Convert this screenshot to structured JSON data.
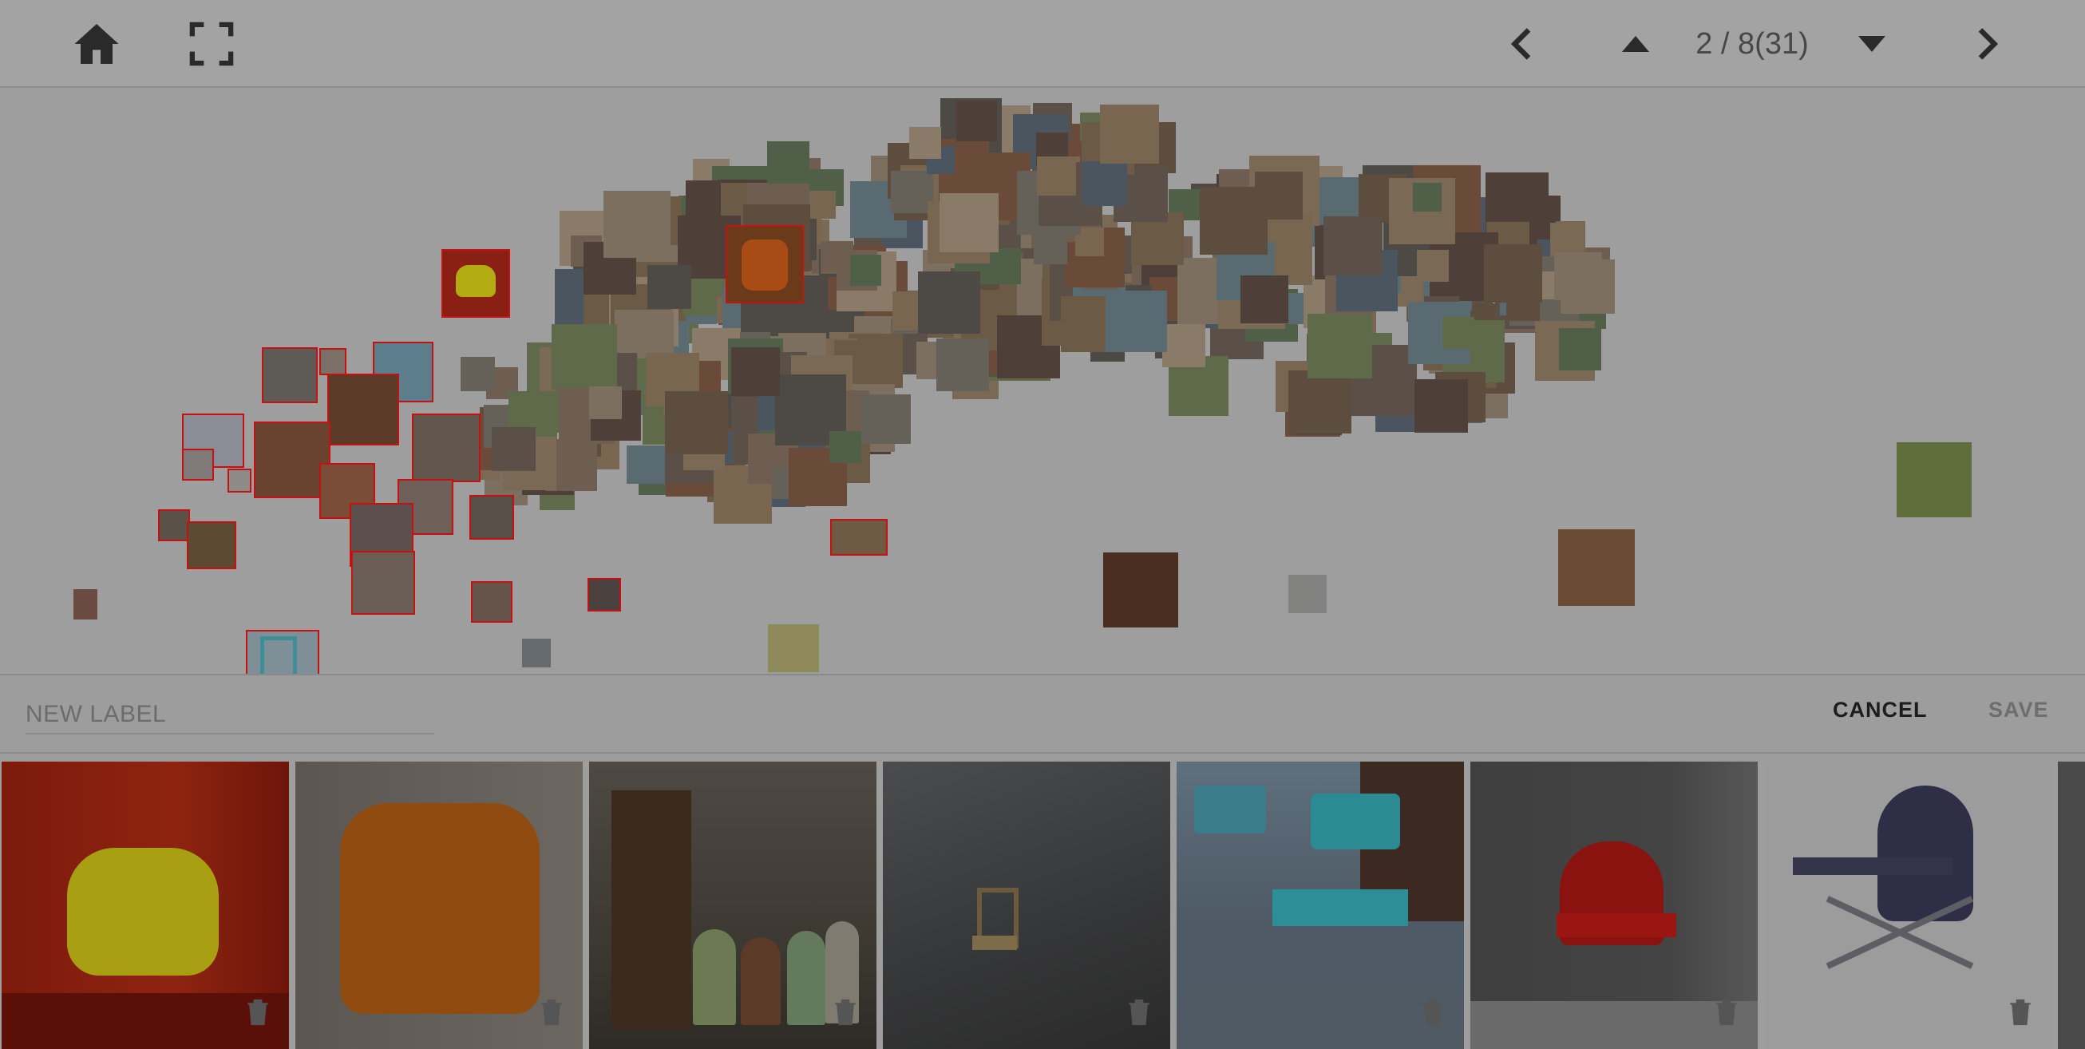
{
  "toolbar": {
    "home_icon": "home-icon",
    "fullscreen_icon": "fullscreen-icon",
    "prev_icon": "chevron-left-icon",
    "up_icon": "triangle-up-icon",
    "down_icon": "triangle-down-icon",
    "next_icon": "chevron-right-icon",
    "page_indicator": "2 / 8(31)"
  },
  "label_bar": {
    "placeholder": "NEW LABEL",
    "cancel_label": "CANCEL",
    "save_label": "SAVE"
  },
  "strip": {
    "items": [
      {
        "subject": "yellow molded armchair",
        "delete_icon": "trash-icon"
      },
      {
        "subject": "orange leather club chair",
        "delete_icon": "trash-icon"
      },
      {
        "subject": "row of painted metal chairs",
        "delete_icon": "trash-icon"
      },
      {
        "subject": "wooden chair against wall",
        "delete_icon": "trash-icon"
      },
      {
        "subject": "turquoise school chairs",
        "delete_icon": "trash-icon"
      },
      {
        "subject": "red metal lawn chair",
        "delete_icon": "trash-icon"
      },
      {
        "subject": "navy folding camp chair",
        "delete_icon": "trash-icon"
      }
    ]
  },
  "colors": {
    "selection_outline": "#c41212",
    "overlay_gray": "#9e9e9e"
  }
}
